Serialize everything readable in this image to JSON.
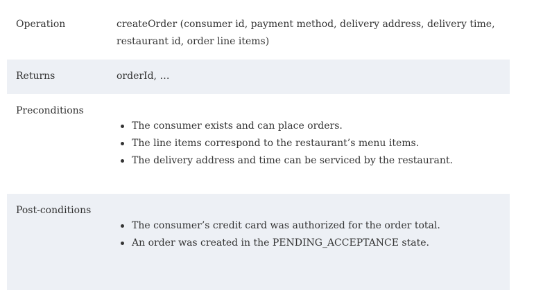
{
  "rows": [
    {
      "label": "Operation",
      "text": "createOrder (consumer id, payment method, delivery address, delivery time, restaurant id, order line items)"
    },
    {
      "label": "Returns",
      "text": "orderId, …"
    },
    {
      "label": "Preconditions",
      "items": [
        "The consumer exists and can place orders.",
        "The line items correspond to the restaurant’s menu items.",
        "The delivery address and time can be serviced by the restaurant."
      ]
    },
    {
      "label": "Post-conditions",
      "items": [
        "The consumer’s credit card was authorized for the order total.",
        "An order was created in the PENDING_ACCEPTANCE state."
      ]
    }
  ],
  "colors": {
    "shaded_row": "#edf0f5",
    "text": "#333333"
  }
}
